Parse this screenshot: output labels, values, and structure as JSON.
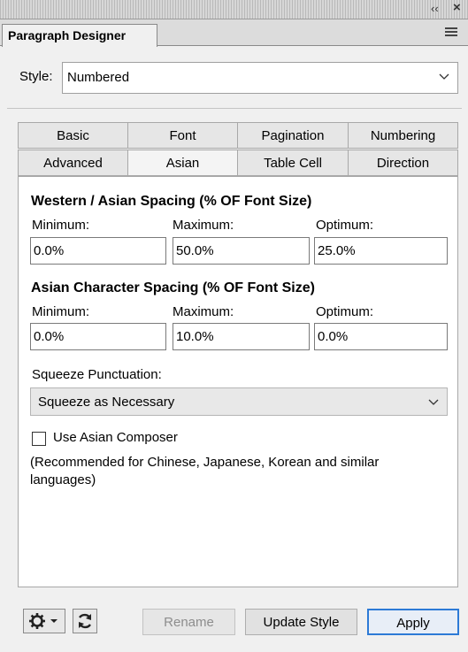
{
  "window": {
    "collapse_glyph": "‹‹",
    "close_glyph": "×"
  },
  "panel": {
    "tab_label": "Paragraph Designer",
    "menu_icon": "hamburger-menu-icon"
  },
  "style_row": {
    "label": "Style:",
    "value": "Numbered"
  },
  "tabs": [
    {
      "label": "Basic"
    },
    {
      "label": "Font"
    },
    {
      "label": "Pagination"
    },
    {
      "label": "Numbering"
    },
    {
      "label": "Advanced"
    },
    {
      "label": "Asian"
    },
    {
      "label": "Table Cell"
    },
    {
      "label": "Direction"
    }
  ],
  "western_asian": {
    "title": "Western / Asian Spacing (% OF Font Size)",
    "min_label": "Minimum:",
    "max_label": "Maximum:",
    "opt_label": "Optimum:",
    "min_value": "0.0%",
    "max_value": "50.0%",
    "opt_value": "25.0%"
  },
  "asian_char": {
    "title": "Asian Character Spacing (% OF Font Size)",
    "min_label": "Minimum:",
    "max_label": "Maximum:",
    "opt_label": "Optimum:",
    "min_value": "0.0%",
    "max_value": "10.0%",
    "opt_value": "0.0%"
  },
  "squeeze": {
    "label": "Squeeze Punctuation:",
    "value": "Squeeze as Necessary"
  },
  "composer": {
    "label": "Use Asian Composer",
    "checked": false,
    "note": "(Recommended for Chinese, Japanese, Korean and similar languages)"
  },
  "buttons": {
    "rename": "Rename",
    "update_style": "Update Style",
    "apply": "Apply"
  }
}
